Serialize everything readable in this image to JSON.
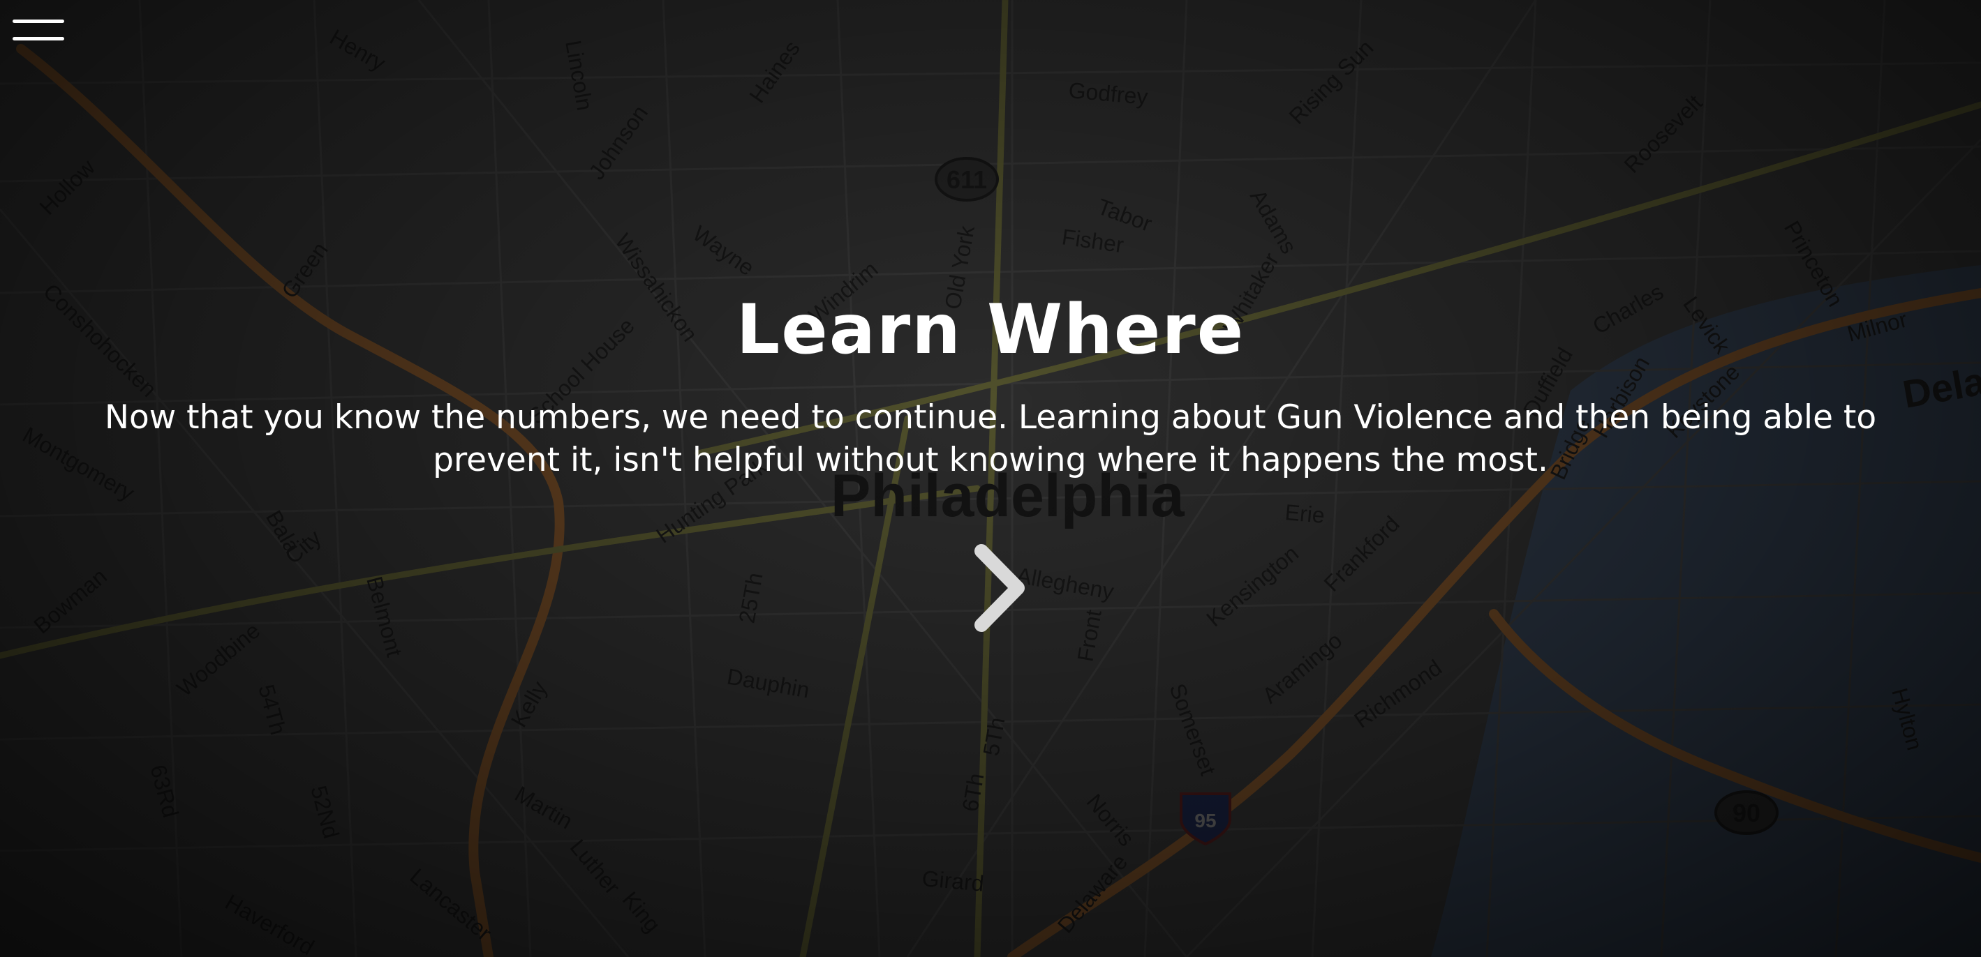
{
  "menu": {
    "icon": "hamburger-menu-icon"
  },
  "map": {
    "labels": [
      "Henry",
      "Lincoln",
      "Haines",
      "Johnson",
      "Godfrey",
      "611",
      "Rising Sun",
      "Roosevelt",
      "Hollow",
      "Green",
      "Wayne",
      "Wissahickon",
      "Old York",
      "Fisher",
      "Tabor",
      "Adams",
      "Whitaker",
      "Princeton",
      "Charles",
      "Levick",
      "Conshohocken",
      "School House",
      "Windrim",
      "Montgomery",
      "Philadelphia",
      "Erie",
      "Kensington",
      "Frankford",
      "Bala",
      "City",
      "Belmont",
      "Woodbine",
      "54Th",
      "Dauphin",
      "25Th",
      "Allegheny",
      "Front",
      "Aramingo",
      "Richmond",
      "Somerset",
      "Kelly",
      "5Th",
      "6Th",
      "95",
      "90",
      "Norris",
      "Martin",
      "Luther",
      "King",
      "Lancaster",
      "Girard",
      "Delaware",
      "Bowman",
      "Haverford",
      "63Rd",
      "52Nd",
      "Hunting Park",
      "Duffield",
      "Bridge",
      "Harbison",
      "Keystone",
      "Milnor",
      "Hylton",
      "Dela"
    ],
    "colors": {
      "background": "#3a3a3a",
      "road": "#4d4d4d",
      "highway": "#8a5a2e",
      "major_road": "#6b6b3a",
      "water": "#39475a"
    }
  },
  "hero": {
    "title": "Learn Where",
    "text": "Now that you know the numbers, we need to continue. Learning about Gun Violence and then being able to prevent it, isn't helpful without knowing where it happens the most."
  },
  "navigation": {
    "next_icon": "chevron-right-icon"
  },
  "colors": {
    "text": "#ffffff",
    "chevron": "#d9d9d9"
  }
}
